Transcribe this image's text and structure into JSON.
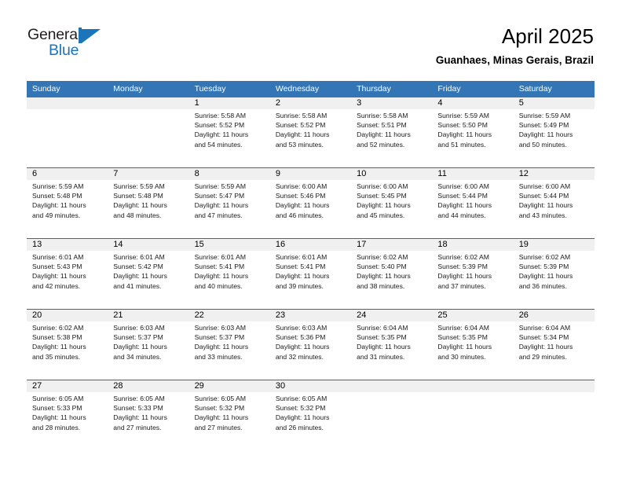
{
  "logo": {
    "word_top": "General",
    "word_bottom": "Blue",
    "accent_color": "#1b75bb"
  },
  "header": {
    "title": "April 2025",
    "subtitle": "Guanhaes, Minas Gerais, Brazil"
  },
  "theme": {
    "header_blue": "#3375b5",
    "separator_blue": "#2e6da4",
    "date_strip_gray": "#f0f0f0"
  },
  "weekdays": [
    "Sunday",
    "Monday",
    "Tuesday",
    "Wednesday",
    "Thursday",
    "Friday",
    "Saturday"
  ],
  "weeks": [
    [
      {
        "day": "",
        "sunrise": "",
        "sunset": "",
        "daylight1": "",
        "daylight2": ""
      },
      {
        "day": "",
        "sunrise": "",
        "sunset": "",
        "daylight1": "",
        "daylight2": ""
      },
      {
        "day": "1",
        "sunrise": "Sunrise: 5:58 AM",
        "sunset": "Sunset: 5:52 PM",
        "daylight1": "Daylight: 11 hours",
        "daylight2": "and 54 minutes."
      },
      {
        "day": "2",
        "sunrise": "Sunrise: 5:58 AM",
        "sunset": "Sunset: 5:52 PM",
        "daylight1": "Daylight: 11 hours",
        "daylight2": "and 53 minutes."
      },
      {
        "day": "3",
        "sunrise": "Sunrise: 5:58 AM",
        "sunset": "Sunset: 5:51 PM",
        "daylight1": "Daylight: 11 hours",
        "daylight2": "and 52 minutes."
      },
      {
        "day": "4",
        "sunrise": "Sunrise: 5:59 AM",
        "sunset": "Sunset: 5:50 PM",
        "daylight1": "Daylight: 11 hours",
        "daylight2": "and 51 minutes."
      },
      {
        "day": "5",
        "sunrise": "Sunrise: 5:59 AM",
        "sunset": "Sunset: 5:49 PM",
        "daylight1": "Daylight: 11 hours",
        "daylight2": "and 50 minutes."
      }
    ],
    [
      {
        "day": "6",
        "sunrise": "Sunrise: 5:59 AM",
        "sunset": "Sunset: 5:48 PM",
        "daylight1": "Daylight: 11 hours",
        "daylight2": "and 49 minutes."
      },
      {
        "day": "7",
        "sunrise": "Sunrise: 5:59 AM",
        "sunset": "Sunset: 5:48 PM",
        "daylight1": "Daylight: 11 hours",
        "daylight2": "and 48 minutes."
      },
      {
        "day": "8",
        "sunrise": "Sunrise: 5:59 AM",
        "sunset": "Sunset: 5:47 PM",
        "daylight1": "Daylight: 11 hours",
        "daylight2": "and 47 minutes."
      },
      {
        "day": "9",
        "sunrise": "Sunrise: 6:00 AM",
        "sunset": "Sunset: 5:46 PM",
        "daylight1": "Daylight: 11 hours",
        "daylight2": "and 46 minutes."
      },
      {
        "day": "10",
        "sunrise": "Sunrise: 6:00 AM",
        "sunset": "Sunset: 5:45 PM",
        "daylight1": "Daylight: 11 hours",
        "daylight2": "and 45 minutes."
      },
      {
        "day": "11",
        "sunrise": "Sunrise: 6:00 AM",
        "sunset": "Sunset: 5:44 PM",
        "daylight1": "Daylight: 11 hours",
        "daylight2": "and 44 minutes."
      },
      {
        "day": "12",
        "sunrise": "Sunrise: 6:00 AM",
        "sunset": "Sunset: 5:44 PM",
        "daylight1": "Daylight: 11 hours",
        "daylight2": "and 43 minutes."
      }
    ],
    [
      {
        "day": "13",
        "sunrise": "Sunrise: 6:01 AM",
        "sunset": "Sunset: 5:43 PM",
        "daylight1": "Daylight: 11 hours",
        "daylight2": "and 42 minutes."
      },
      {
        "day": "14",
        "sunrise": "Sunrise: 6:01 AM",
        "sunset": "Sunset: 5:42 PM",
        "daylight1": "Daylight: 11 hours",
        "daylight2": "and 41 minutes."
      },
      {
        "day": "15",
        "sunrise": "Sunrise: 6:01 AM",
        "sunset": "Sunset: 5:41 PM",
        "daylight1": "Daylight: 11 hours",
        "daylight2": "and 40 minutes."
      },
      {
        "day": "16",
        "sunrise": "Sunrise: 6:01 AM",
        "sunset": "Sunset: 5:41 PM",
        "daylight1": "Daylight: 11 hours",
        "daylight2": "and 39 minutes."
      },
      {
        "day": "17",
        "sunrise": "Sunrise: 6:02 AM",
        "sunset": "Sunset: 5:40 PM",
        "daylight1": "Daylight: 11 hours",
        "daylight2": "and 38 minutes."
      },
      {
        "day": "18",
        "sunrise": "Sunrise: 6:02 AM",
        "sunset": "Sunset: 5:39 PM",
        "daylight1": "Daylight: 11 hours",
        "daylight2": "and 37 minutes."
      },
      {
        "day": "19",
        "sunrise": "Sunrise: 6:02 AM",
        "sunset": "Sunset: 5:39 PM",
        "daylight1": "Daylight: 11 hours",
        "daylight2": "and 36 minutes."
      }
    ],
    [
      {
        "day": "20",
        "sunrise": "Sunrise: 6:02 AM",
        "sunset": "Sunset: 5:38 PM",
        "daylight1": "Daylight: 11 hours",
        "daylight2": "and 35 minutes."
      },
      {
        "day": "21",
        "sunrise": "Sunrise: 6:03 AM",
        "sunset": "Sunset: 5:37 PM",
        "daylight1": "Daylight: 11 hours",
        "daylight2": "and 34 minutes."
      },
      {
        "day": "22",
        "sunrise": "Sunrise: 6:03 AM",
        "sunset": "Sunset: 5:37 PM",
        "daylight1": "Daylight: 11 hours",
        "daylight2": "and 33 minutes."
      },
      {
        "day": "23",
        "sunrise": "Sunrise: 6:03 AM",
        "sunset": "Sunset: 5:36 PM",
        "daylight1": "Daylight: 11 hours",
        "daylight2": "and 32 minutes."
      },
      {
        "day": "24",
        "sunrise": "Sunrise: 6:04 AM",
        "sunset": "Sunset: 5:35 PM",
        "daylight1": "Daylight: 11 hours",
        "daylight2": "and 31 minutes."
      },
      {
        "day": "25",
        "sunrise": "Sunrise: 6:04 AM",
        "sunset": "Sunset: 5:35 PM",
        "daylight1": "Daylight: 11 hours",
        "daylight2": "and 30 minutes."
      },
      {
        "day": "26",
        "sunrise": "Sunrise: 6:04 AM",
        "sunset": "Sunset: 5:34 PM",
        "daylight1": "Daylight: 11 hours",
        "daylight2": "and 29 minutes."
      }
    ],
    [
      {
        "day": "27",
        "sunrise": "Sunrise: 6:05 AM",
        "sunset": "Sunset: 5:33 PM",
        "daylight1": "Daylight: 11 hours",
        "daylight2": "and 28 minutes."
      },
      {
        "day": "28",
        "sunrise": "Sunrise: 6:05 AM",
        "sunset": "Sunset: 5:33 PM",
        "daylight1": "Daylight: 11 hours",
        "daylight2": "and 27 minutes."
      },
      {
        "day": "29",
        "sunrise": "Sunrise: 6:05 AM",
        "sunset": "Sunset: 5:32 PM",
        "daylight1": "Daylight: 11 hours",
        "daylight2": "and 27 minutes."
      },
      {
        "day": "30",
        "sunrise": "Sunrise: 6:05 AM",
        "sunset": "Sunset: 5:32 PM",
        "daylight1": "Daylight: 11 hours",
        "daylight2": "and 26 minutes."
      },
      {
        "day": "",
        "sunrise": "",
        "sunset": "",
        "daylight1": "",
        "daylight2": ""
      },
      {
        "day": "",
        "sunrise": "",
        "sunset": "",
        "daylight1": "",
        "daylight2": ""
      },
      {
        "day": "",
        "sunrise": "",
        "sunset": "",
        "daylight1": "",
        "daylight2": ""
      }
    ]
  ]
}
